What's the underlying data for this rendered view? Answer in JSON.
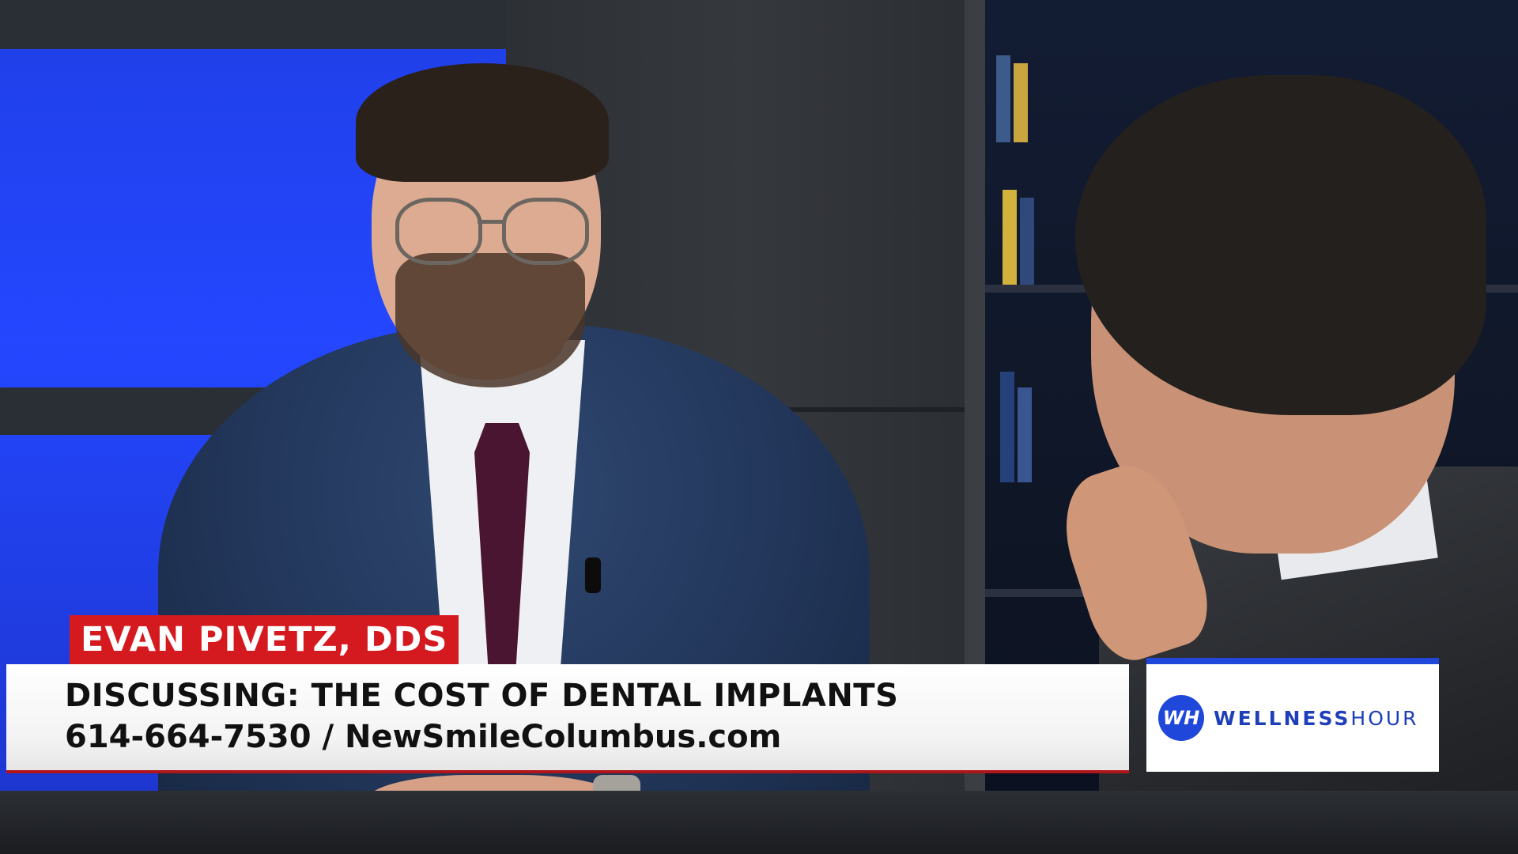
{
  "lower_third": {
    "name": "EVAN PIVETZ, DDS",
    "topic": "DISCUSSING: THE COST OF DENTAL IMPLANTS",
    "contact": "614-664-7530 / NewSmileColumbus.com"
  },
  "logo": {
    "mark": "WH",
    "word_bold": "WELLNESS",
    "word_light": "HOUR"
  },
  "colors": {
    "name_tag_red": "#d41a1f",
    "logo_blue": "#1f47d9",
    "studio_blue": "#2447ff"
  }
}
